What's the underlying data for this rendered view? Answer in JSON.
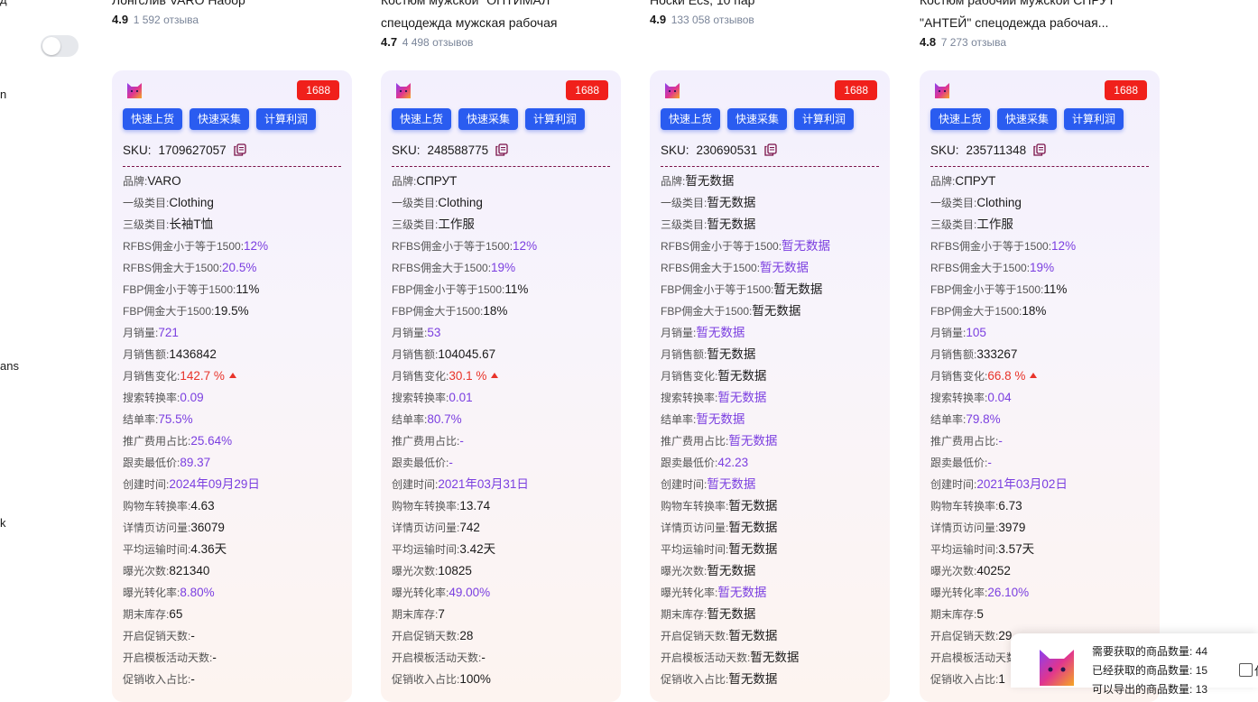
{
  "sidebar": {
    "fragments": [
      "д",
      "n",
      "ans",
      "k"
    ]
  },
  "products": [
    {
      "title": "Лонгслив VARO Набор",
      "rating": "4.9",
      "reviews": "1 592 отзыва"
    },
    {
      "title": "Костюм мужской \"ОПТИМАЛ\" спецодежда мужская рабочая",
      "rating": "4.7",
      "reviews": "4 498 отзывов"
    },
    {
      "title": "Носки Ecs, 10 пар",
      "rating": "4.9",
      "reviews": "133 058 отзывов"
    },
    {
      "title": "Костюм рабочий мужской СПРУТ \"АНТЕЙ\" спецодежда рабочая...",
      "rating": "4.8",
      "reviews": "7 273 отзыва"
    }
  ],
  "card_common": {
    "badge": "1688",
    "btn_upload": "快速上货",
    "btn_collect": "快速采集",
    "btn_profit": "计算利润",
    "sku_label": "SKU:",
    "labels": [
      "品牌:",
      "一级类目:",
      "三级类目:",
      "RFBS佣金小于等于1500:",
      "RFBS佣金大于1500:",
      "FBP佣金小于等于1500:",
      "FBP佣金大于1500:",
      "月销量:",
      "月销售额:",
      "月销售变化:",
      "搜索转换率:",
      "结单率:",
      "推广费用占比:",
      "跟卖最低价:",
      "创建时间:",
      "购物车转换率:",
      "详情页访问量:",
      "平均运输时间:",
      "曝光次数:",
      "曝光转化率:",
      "期末库存:",
      "开启促销天数:",
      "开启模板活动天数:",
      "促销收入占比:"
    ]
  },
  "cards": [
    {
      "sku": "1709627057",
      "values": [
        "VARO",
        "Clothing",
        "长袖T恤",
        "12%",
        "20.5%",
        "11%",
        "19.5%",
        "721",
        "1436842",
        "142.7 %",
        "0.09",
        "75.5%",
        "25.64%",
        "89.37",
        "2024年09月29日",
        "4.63",
        "36079",
        "4.36天",
        "821340",
        "8.80%",
        "65",
        "-",
        "-",
        "-"
      ]
    },
    {
      "sku": "248588775",
      "values": [
        "СПРУТ",
        "Clothing",
        "工作服",
        "12%",
        "19%",
        "11%",
        "18%",
        "53",
        "104045.67",
        "30.1 %",
        "0.01",
        "80.7%",
        "-",
        "-",
        "2021年03月31日",
        "13.74",
        "742",
        "3.42天",
        "10825",
        "49.00%",
        "7",
        "28",
        "-",
        "100%"
      ]
    },
    {
      "sku": "230690531",
      "values": [
        "暂无数据",
        "暂无数据",
        "暂无数据",
        "暂无数据",
        "暂无数据",
        "暂无数据",
        "暂无数据",
        "暂无数据",
        "暂无数据",
        "暂无数据",
        "暂无数据",
        "暂无数据",
        "暂无数据",
        "42.23",
        "暂无数据",
        "暂无数据",
        "暂无数据",
        "暂无数据",
        "暂无数据",
        "暂无数据",
        "暂无数据",
        "暂无数据",
        "暂无数据",
        "暂无数据"
      ]
    },
    {
      "sku": "235711348",
      "values": [
        "СПРУТ",
        "Clothing",
        "工作服",
        "12%",
        "19%",
        "11%",
        "18%",
        "105",
        "333267",
        "66.8 %",
        "0.04",
        "79.8%",
        "-",
        "-",
        "2021年03月02日",
        "6.73",
        "3979",
        "3.57天",
        "40252",
        "26.10%",
        "5",
        "29",
        "",
        "1"
      ]
    }
  ],
  "float_panel": {
    "need_label": "需要获取的商品数量:",
    "need_value": "44",
    "got_label": "已经获取的商品数量:",
    "got_value": "15",
    "export_label": "可以导出的商品数量:",
    "export_value": "13",
    "checkbox_label": "仅"
  },
  "colors": {
    "button": "#2a5cf0",
    "badge": "#f0201b",
    "purple_value": "#7b3fe0",
    "red_value": "#e8332a",
    "divider": "#7a1248"
  },
  "icons": {
    "card_logo": "cat-logo-icon",
    "copy": "copy-icon",
    "trend": "arrow-up-icon"
  }
}
